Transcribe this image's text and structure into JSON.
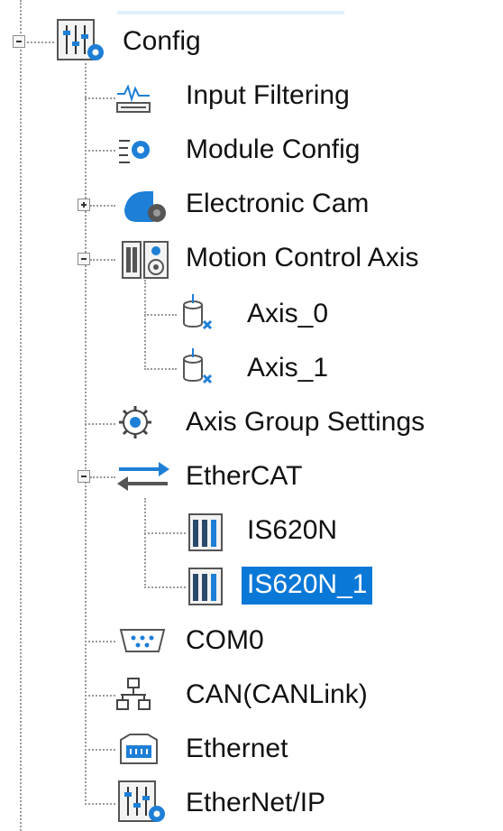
{
  "tree": {
    "config": "Config",
    "input_filtering": "Input Filtering",
    "module_config": "Module Config",
    "electronic_cam": "Electronic Cam",
    "motion_control_axis": "Motion Control Axis",
    "axis_0": "Axis_0",
    "axis_1": "Axis_1",
    "axis_group_settings": "Axis Group Settings",
    "ethercat": "EtherCAT",
    "is620n": "IS620N",
    "is620n_1": "IS620N_1",
    "com0": "COM0",
    "can": "CAN(CANLink)",
    "ethernet": "Ethernet",
    "ethernet_ip": "EtherNet/IP"
  },
  "colors": {
    "selection": "#0a78d7",
    "icon_blue": "#1e7fd6"
  }
}
